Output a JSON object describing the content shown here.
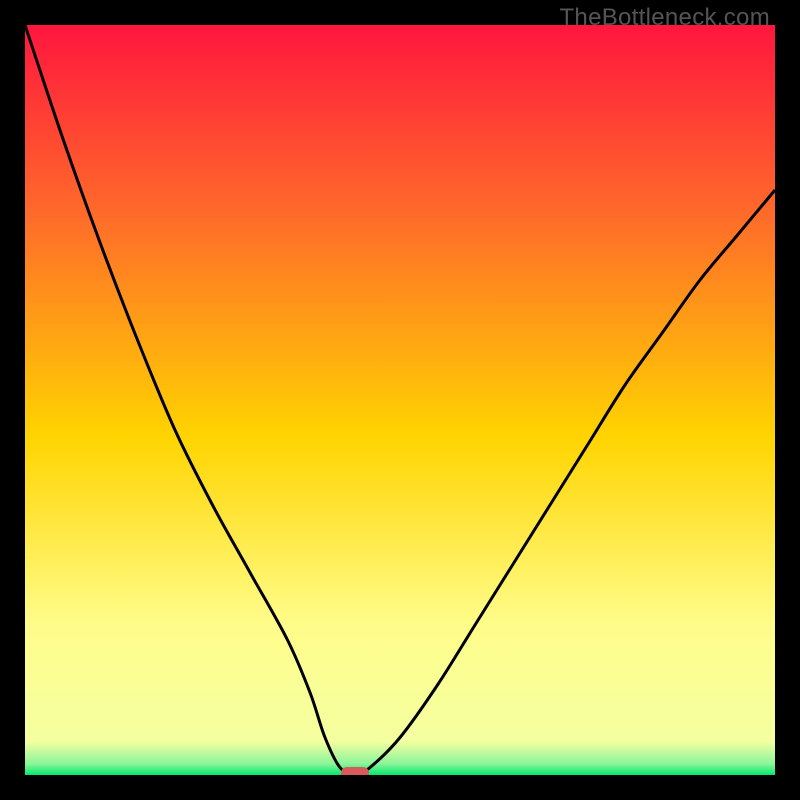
{
  "watermark": "TheBottleneck.com",
  "colors": {
    "grad_top": "#ff163e",
    "grad_mid_upper": "#ff6a2a",
    "grad_mid": "#ffd400",
    "grad_low": "#fffd8a",
    "grad_bottom": "#00e86c",
    "curve": "#000000",
    "marker": "#d85a5a",
    "frame_bg": "#000000"
  },
  "chart_data": {
    "type": "line",
    "title": "",
    "xlabel": "",
    "ylabel": "",
    "xlim": [
      0,
      100
    ],
    "ylim": [
      0,
      100
    ],
    "series": [
      {
        "name": "bottleneck-curve",
        "x": [
          0,
          5,
          10,
          15,
          20,
          25,
          30,
          35,
          38,
          40,
          42,
          44,
          46,
          50,
          55,
          60,
          65,
          70,
          75,
          80,
          85,
          90,
          95,
          100
        ],
        "values": [
          100,
          85,
          71,
          58,
          46,
          36,
          27,
          18,
          11,
          5,
          1,
          0,
          1,
          5,
          12,
          20,
          28,
          36,
          44,
          52,
          59,
          66,
          72,
          78
        ]
      }
    ],
    "marker": {
      "x": 44,
      "y": 0
    },
    "gradient_stops": [
      {
        "pos": 0.0,
        "color": "#ff163e"
      },
      {
        "pos": 0.25,
        "color": "#ff6a2a"
      },
      {
        "pos": 0.55,
        "color": "#ffd400"
      },
      {
        "pos": 0.8,
        "color": "#fffd8a"
      },
      {
        "pos": 0.955,
        "color": "#f4ffa0"
      },
      {
        "pos": 0.985,
        "color": "#8cf59a"
      },
      {
        "pos": 1.0,
        "color": "#00e86c"
      }
    ]
  }
}
